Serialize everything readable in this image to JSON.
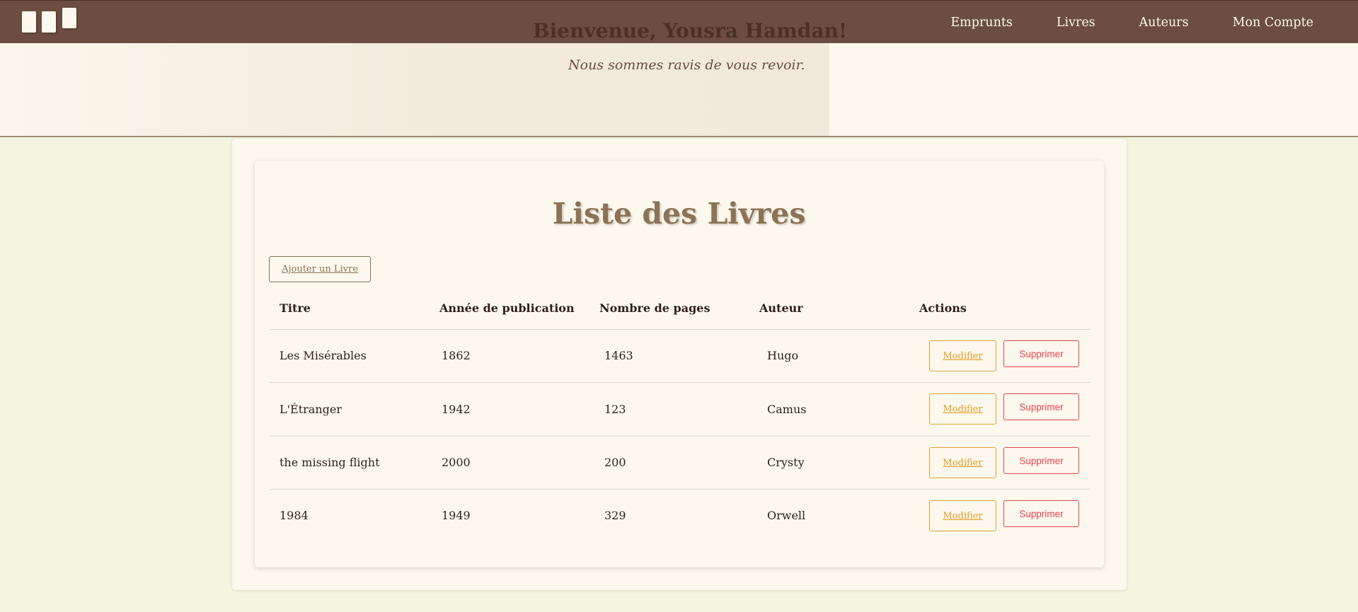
{
  "nav": {
    "logo_icon": "books-logo-icon",
    "links": [
      "Emprunts",
      "Livres",
      "Auteurs",
      "Mon Compte"
    ]
  },
  "hero": {
    "title": "Bienvenue, Yousra Hamdan!",
    "subtitle": "Nous sommes ravis de vous revoir."
  },
  "main": {
    "title": "Liste des Livres",
    "add_button": "Ajouter un Livre",
    "columns": [
      "Titre",
      "Année de publication",
      "Nombre de pages",
      "Auteur",
      "Actions"
    ],
    "rows": [
      {
        "titre": "Les Misérables",
        "annee": "1862",
        "pages": "1463",
        "auteur": "Hugo"
      },
      {
        "titre": "L'Étranger",
        "annee": "1942",
        "pages": "123",
        "auteur": "Camus"
      },
      {
        "titre": "the missing flight",
        "annee": "2000",
        "pages": "200",
        "auteur": "Crysty"
      },
      {
        "titre": "1984",
        "annee": "1949",
        "pages": "329",
        "auteur": "Orwell"
      }
    ],
    "modify_label": "Modifier",
    "delete_label": "Supprimer"
  },
  "colors": {
    "navbar": "#6b4d42",
    "page_background": "#f4f5e1",
    "card_background": "#fdf8ee",
    "title_color": "#8b7355",
    "modify_accent": "#e0a43b",
    "delete_accent": "#e2434b"
  }
}
